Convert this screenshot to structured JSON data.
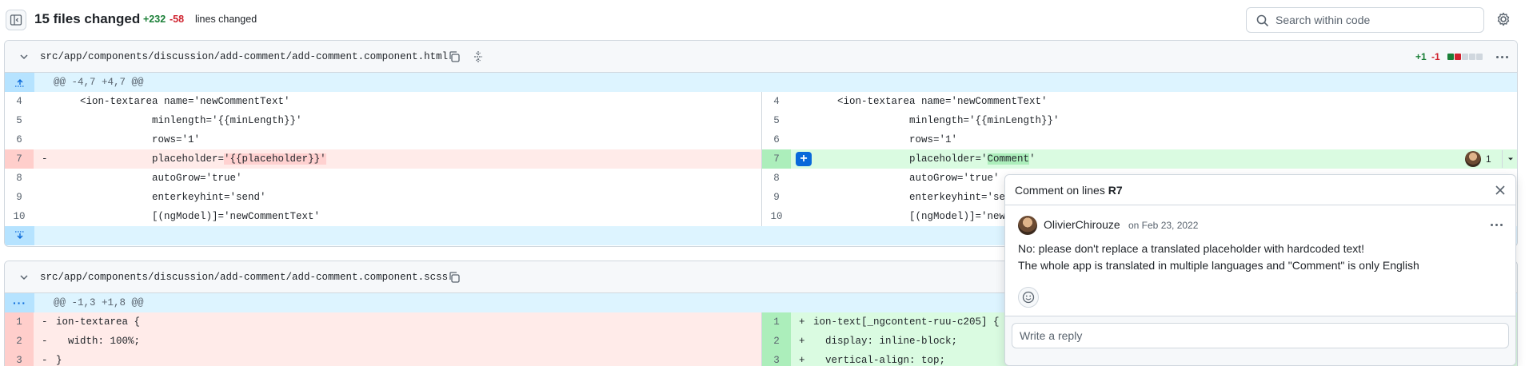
{
  "toolbar": {
    "files_changed": "15 files changed",
    "additions": "+232",
    "deletions": "-58",
    "lines_changed": "lines changed",
    "search_placeholder": "Search within code"
  },
  "file1": {
    "path": "src/app/components/discussion/add-comment/add-comment.component.html",
    "stat_add": "+1",
    "stat_del": "-1",
    "hunk": "@@ -4,7 +4,7 @@",
    "left": [
      {
        "n": "4",
        "sign": "",
        "code": "    <ion-textarea name='newCommentText'"
      },
      {
        "n": "5",
        "sign": "",
        "code": "                minlength='{{minLength}}'"
      },
      {
        "n": "6",
        "sign": "",
        "code": "                rows='1'"
      },
      {
        "n": "7",
        "sign": "-",
        "pre": "                placeholder=",
        "hl": "'{{placeholder}}'"
      },
      {
        "n": "8",
        "sign": "",
        "code": "                autoGrow='true'"
      },
      {
        "n": "9",
        "sign": "",
        "code": "                enterkeyhint='send'"
      },
      {
        "n": "10",
        "sign": "",
        "code": "                [(ngModel)]='newCommentText'"
      }
    ],
    "right": [
      {
        "n": "4",
        "code": "    <ion-textarea name='newCommentText'"
      },
      {
        "n": "5",
        "code": "                minlength='{{minLength}}'"
      },
      {
        "n": "6",
        "code": "                rows='1'"
      },
      {
        "n": "7",
        "pre": "                placeholder='",
        "hl": "Comment",
        "post": "'"
      },
      {
        "n": "8",
        "code": "                autoGrow='true'"
      },
      {
        "n": "9",
        "code": "                enterkeyhint='se"
      },
      {
        "n": "10",
        "code": "                [(ngModel)]='new"
      }
    ],
    "comment_count": "1"
  },
  "file2": {
    "path": "src/app/components/discussion/add-comment/add-comment.component.scss",
    "hunk": "@@ -1,3 +1,8 @@",
    "left": [
      {
        "n": "1",
        "sign": "-",
        "code": "ion-textarea {"
      },
      {
        "n": "2",
        "sign": "-",
        "code": "  width: 100%;"
      },
      {
        "n": "3",
        "sign": "-",
        "code": "}"
      }
    ],
    "right": [
      {
        "n": "1",
        "sign": "+",
        "code": "ion-text[_ngcontent-ruu-c205] {"
      },
      {
        "n": "2",
        "sign": "+",
        "code": "  display: inline-block;"
      },
      {
        "n": "3",
        "sign": "+",
        "code": "  vertical-align: top;"
      }
    ]
  },
  "comment": {
    "title_prefix": "Comment on lines ",
    "title_lines": "R7",
    "author": "OlivierChirouze",
    "date": "on Feb 23, 2022",
    "line1": "No: please don't replace a translated placeholder with hardcoded text!",
    "line2": "The whole app is translated in multiple languages and \"Comment\" is only English",
    "reply_placeholder": "Write a reply"
  },
  "icons": [
    "sidebar-toggle-icon",
    "search-icon",
    "gear-icon",
    "chevron-down-icon",
    "copy-icon",
    "expand-icon",
    "kebab-icon",
    "close-icon",
    "smiley-icon",
    "plus-icon",
    "expand-up-icon",
    "expand-down-icon"
  ],
  "colors": {
    "add": "#1a7f37",
    "del": "#cf222e",
    "accent": "#0969da",
    "add_bg": "#dafbe1",
    "del_bg": "#ffebe9",
    "hunk_bg": "#ddf4ff"
  }
}
